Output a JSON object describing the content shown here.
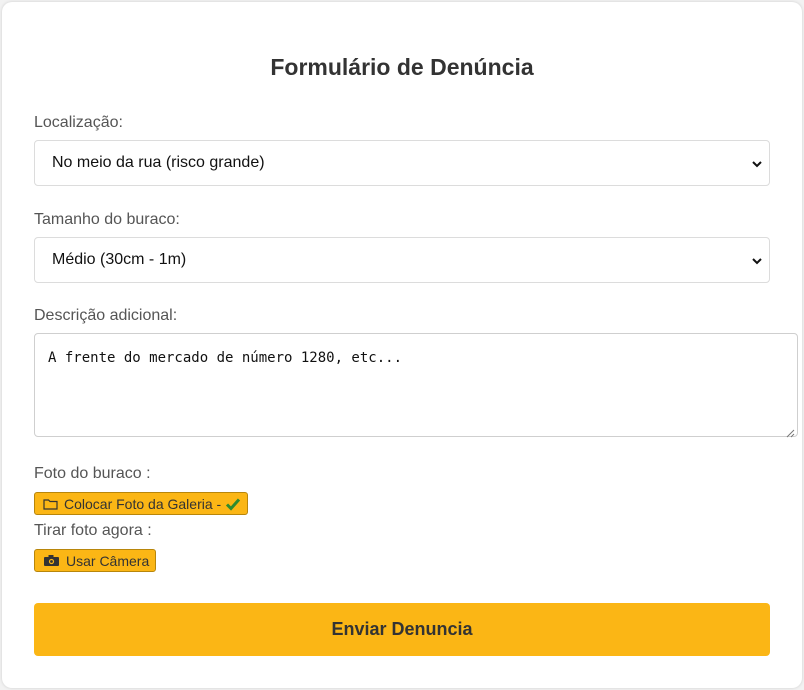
{
  "form": {
    "title": "Formulário de Denúncia",
    "location": {
      "label": "Localização:",
      "selected": "No meio da rua (risco grande)"
    },
    "size": {
      "label": "Tamanho do buraco:",
      "selected": "Médio (30cm - 1m)"
    },
    "description": {
      "label": "Descrição adicional:",
      "value": "A frente do mercado de número 1280, etc..."
    },
    "photo": {
      "label": "Foto do buraco :",
      "gallery_button": "Colocar Foto da Galeria -",
      "gallery_icon": "folder-icon",
      "status_icon": "check-icon"
    },
    "camera": {
      "label": "Tirar foto agora :",
      "camera_button": "Usar Câmera",
      "camera_icon": "camera-icon"
    },
    "submit_label": "Enviar Denuncia"
  },
  "colors": {
    "accent": "#fbb615",
    "check": "#2e8b2e",
    "text": "#333333"
  }
}
